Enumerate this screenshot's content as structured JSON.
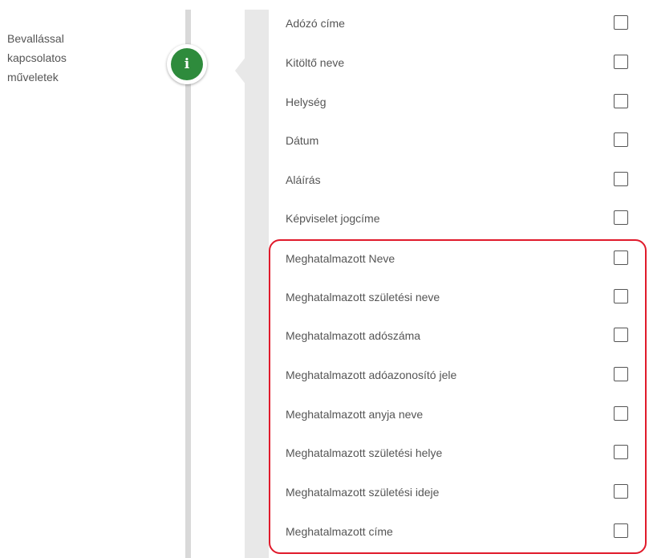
{
  "sidebar": {
    "label_lines": [
      "Bevallással",
      "kapcsolatos",
      "műveletek"
    ]
  },
  "step_icon": {
    "glyph": "i",
    "color": "#2e8b3c"
  },
  "fields": [
    {
      "label": "Adózó címe",
      "checked": false
    },
    {
      "label": "Kitöltő neve",
      "checked": false
    },
    {
      "label": "Helység",
      "checked": false
    },
    {
      "label": "Dátum",
      "checked": false
    },
    {
      "label": "Aláírás",
      "checked": false
    },
    {
      "label": "Képviselet jogcíme",
      "checked": false
    },
    {
      "label": "Meghatalmazott Neve",
      "checked": false
    },
    {
      "label": "Meghatalmazott születési neve",
      "checked": false
    },
    {
      "label": "Meghatalmazott adószáma",
      "checked": false
    },
    {
      "label": "Meghatalmazott adóazonosító jele",
      "checked": false
    },
    {
      "label": "Meghatalmazott anyja neve",
      "checked": false
    },
    {
      "label": "Meghatalmazott születési helye",
      "checked": false
    },
    {
      "label": "Meghatalmazott születési ideje",
      "checked": false
    },
    {
      "label": "Meghatalmazott címe",
      "checked": false
    }
  ],
  "highlight": {
    "color": "#e01a2b"
  }
}
